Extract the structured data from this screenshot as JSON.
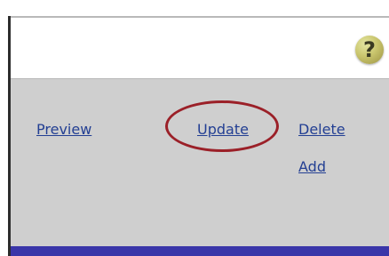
{
  "header": {
    "help_icon_text": "?"
  },
  "actions": {
    "preview_label": "Preview",
    "update_label": "Update",
    "delete_label": "Delete",
    "add_label": "Add"
  },
  "colors": {
    "link": "#233f93",
    "panel": "#cfcfcf",
    "bottom_bar": "#3a36a9",
    "annotation": "#9b2028"
  }
}
